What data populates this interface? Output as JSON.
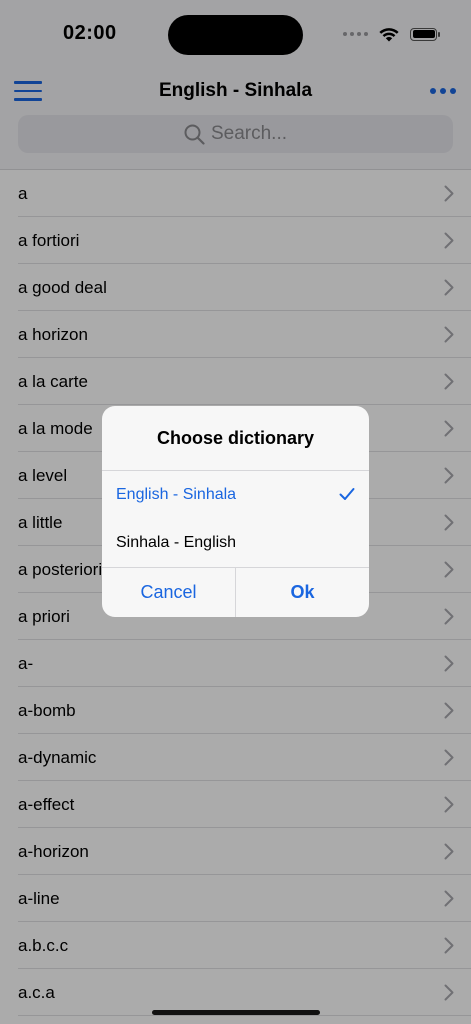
{
  "status": {
    "time": "02:00"
  },
  "nav": {
    "title": "English - Sinhala",
    "search_placeholder": "Search..."
  },
  "words": [
    "a",
    "a fortiori",
    "a good deal",
    "a horizon",
    "a la carte",
    "a la mode",
    "a level",
    "a little",
    "a posteriori",
    "a priori",
    "a-",
    "a-bomb",
    "a-dynamic",
    "a-effect",
    "a-horizon",
    "a-line",
    "a.b.c.c",
    "a.c.a"
  ],
  "dialog": {
    "title": "Choose dictionary",
    "options": [
      {
        "label": "English - Sinhala",
        "selected": true
      },
      {
        "label": "Sinhala - English",
        "selected": false
      }
    ],
    "cancel_label": "Cancel",
    "ok_label": "Ok"
  },
  "colors": {
    "accent": "#1a66e0",
    "background": "#f4f4f6"
  },
  "icons": [
    "menu-icon",
    "more-icon",
    "search-icon",
    "chevron-right-icon",
    "checkmark-icon",
    "wifi-icon",
    "battery-icon",
    "cellular-icon"
  ]
}
